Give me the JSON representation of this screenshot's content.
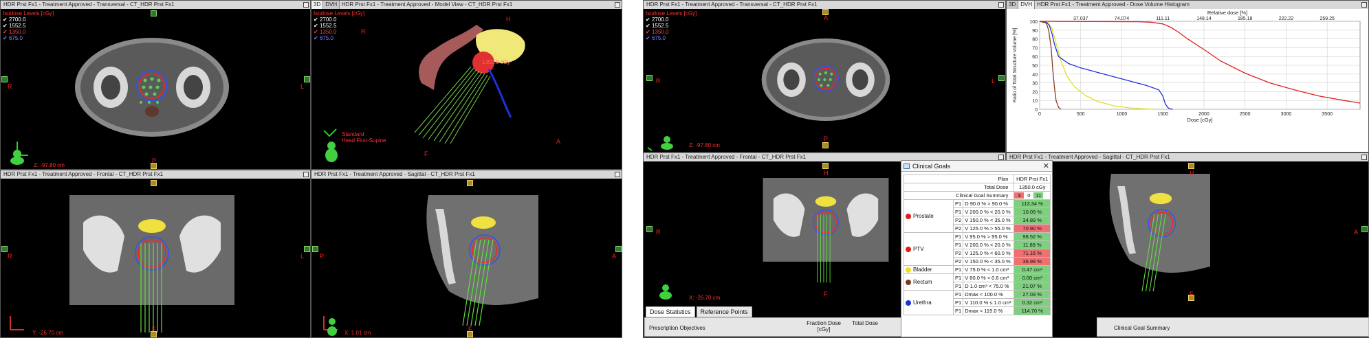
{
  "left": {
    "transversal": {
      "title": "HDR Prst Fx1 - Treatment Approved - Transversal - CT_HDR Prst Fx1",
      "legend_title": "Isodose Levels [cGy]",
      "coord": "Z: -97.80 cm",
      "labels": {
        "top": "H",
        "bottom": "P",
        "left": "R",
        "right": "L"
      }
    },
    "model_view": {
      "tab_3d": "3D",
      "tab_dvh": "DVH",
      "title": "HDR Prst Fx1 - Treatment Approved - Model View - CT_HDR Prst Fx1",
      "legend_title": "Isodose Levels [cGy]",
      "labels": {
        "top": "H",
        "right": "A",
        "left": "R",
        "bottom": "F"
      },
      "dose_label": "1350.0 cGy",
      "orientation_text": [
        "Standard",
        "Head First-Supine"
      ]
    },
    "frontal": {
      "title": "HDR Prst Fx1 - Treatment Approved - Frontal - CT_HDR Prst Fx1",
      "coord": "Y: -26.70 cm",
      "labels": {
        "top": "H",
        "bottom": "F",
        "left": "R",
        "right": "L"
      }
    },
    "sagittal": {
      "title": "HDR Prst Fx1 - Treatment Approved - Sagittal - CT_HDR Prst Fx1",
      "coord": "X: 1.01 cm",
      "labels": {
        "top": "H",
        "bottom": "F",
        "left": "P",
        "right": "A"
      }
    }
  },
  "right": {
    "transversal": {
      "title": "HDR Prst Fx1 - Treatment Approved - Transversal - CT_HDR Prst Fx1",
      "legend_title": "Isodose Levels [cGy]",
      "coord": "Z: -97.80 cm",
      "labels": {
        "top": "A",
        "bottom": "P",
        "left": "R",
        "right": "L"
      }
    },
    "dvh": {
      "tab_3d": "3D",
      "tab_dvh": "DVH",
      "title": "HDR Prst Fx1 - Treatment Approved - Dose Volume Histogram"
    },
    "frontal": {
      "title": "HDR Prst Fx1 - Treatment Approved - Frontal - CT_HDR Prst Fx1",
      "coord": "X: -26.70 cm",
      "labels": {
        "top": "H",
        "bottom": "F",
        "left": "R",
        "right": "L"
      }
    },
    "sagittal": {
      "title": "HDR Prst Fx1 - Treatment Approved - Sagittal - CT_HDR Prst Fx1",
      "labels": {
        "top": "H",
        "bottom": "F",
        "right": "A"
      }
    }
  },
  "isodose_levels": [
    "2700.0",
    "1552.5",
    "1350.0",
    "675.0"
  ],
  "isodose_colors": [
    "#ffffff",
    "#ffffff",
    "#ff3030",
    "#7070ff"
  ],
  "clinical_goals": {
    "title": "Clinical Goals",
    "plan_label": "Plan",
    "plan_name": "HDR Prst Fx1",
    "total_dose_label": "Total Dose",
    "total_dose": "1350.0 cGy",
    "summary_label": "Clinical Goal Summary",
    "summary_counts": [
      "3",
      "0",
      "11"
    ],
    "structures": [
      {
        "name": "Prostate",
        "color": "#e81818",
        "rows": [
          {
            "p": "P1",
            "goal": "D 90.0 % > 90.0 %",
            "value": "113.34 %",
            "status": "pass"
          },
          {
            "p": "P1",
            "goal": "V 200.0 % < 20.0 %",
            "value": "10.09 %",
            "status": "pass"
          },
          {
            "p": "P2",
            "goal": "V 150.0 % < 35.0 %",
            "value": "34.89 %",
            "status": "pass"
          },
          {
            "p": "P2",
            "goal": "V 125.0 % > 55.0 %",
            "value": "70.90 %",
            "status": "fail"
          }
        ]
      },
      {
        "name": "PTV",
        "color": "#e81818",
        "rows": [
          {
            "p": "P1",
            "goal": "V 95.0 % > 95.0 %",
            "value": "98.52 %",
            "status": "pass"
          },
          {
            "p": "P1",
            "goal": "V 200.0 % < 20.0 %",
            "value": "11.89 %",
            "status": "pass"
          },
          {
            "p": "P2",
            "goal": "V 125.0 % < 60.0 %",
            "value": "71.16 %",
            "status": "fail"
          },
          {
            "p": "P2",
            "goal": "V 150.0 % < 35.0 %",
            "value": "36.99 %",
            "status": "fail"
          }
        ]
      },
      {
        "name": "Bladder",
        "color": "#f0e020",
        "rows": [
          {
            "p": "P1",
            "goal": "V 75.0 % < 1.0 cm³",
            "value": "0.47 cm³",
            "status": "pass"
          }
        ]
      },
      {
        "name": "Rectum",
        "color": "#7a3a22",
        "rows": [
          {
            "p": "P1",
            "goal": "V 80.0 % < 0.6 cm³",
            "value": "0.00 cm³",
            "status": "pass"
          },
          {
            "p": "P1",
            "goal": "D 1.0 cm³ < 75.0 %",
            "value": "21.07 %",
            "status": "pass"
          }
        ]
      },
      {
        "name": "Urethra",
        "color": "#1830e0",
        "rows": [
          {
            "p": "P1",
            "goal": "Dmax < 100.0 %",
            "value": "27.03 %",
            "status": "pass"
          },
          {
            "p": "P1",
            "goal": "V 110.0 % ≤ 1.0 cm³",
            "value": "0.32 cm³",
            "status": "pass"
          },
          {
            "p": "P1",
            "goal": "Dmax < 115.0 %",
            "value": "114.70 %",
            "status": "pass"
          }
        ]
      }
    ]
  },
  "bottom": {
    "tab_dose_statistics": "Dose Statistics",
    "tab_reference_points": "Reference Points",
    "prescription_objectives": "Prescription Objectives",
    "fraction_dose": "Fraction Dose [cGy]",
    "total_dose": "Total Dose",
    "clinical_goal_summary": "Clinical Goal Summary"
  },
  "chart_data": {
    "type": "line",
    "title": "",
    "xlabel": "Dose [cGy]",
    "ylabel": "Ratio of Total Structure Volume [%]",
    "x2label": "Relative dose [%]",
    "xlim": [
      0,
      3900
    ],
    "ylim": [
      0,
      100
    ],
    "xticks": [
      0,
      500,
      1000,
      1500,
      2000,
      2500,
      3000,
      3500
    ],
    "yticks": [
      0,
      10,
      20,
      30,
      40,
      50,
      60,
      70,
      80,
      90,
      100
    ],
    "x2ticks": [
      "37.037",
      "74.074",
      "111.11",
      "148.14",
      "185.18",
      "222.22",
      "259.25"
    ],
    "x2tick_dose": [
      500,
      1000,
      1500,
      2000,
      2500,
      3000,
      3500
    ],
    "grid": true,
    "series": [
      {
        "color": "#e02020",
        "x": [
          0,
          1200,
          1350,
          1500,
          1600,
          1700,
          1800,
          2000,
          2200,
          2500,
          2800,
          3100,
          3400,
          3700,
          3900
        ],
        "y": [
          100,
          99.5,
          99,
          97,
          93,
          87,
          80,
          68,
          55,
          41,
          30,
          22,
          15,
          10,
          7
        ]
      },
      {
        "color": "#e0e020",
        "x": [
          0,
          100,
          150,
          200,
          260,
          330,
          420,
          550,
          700,
          900,
          1100,
          1300,
          1400
        ],
        "y": [
          100,
          99,
          92,
          75,
          55,
          38,
          26,
          16,
          9,
          4,
          1.5,
          0.3,
          0
        ]
      },
      {
        "color": "#2030e0",
        "x": [
          0,
          80,
          120,
          150,
          180,
          230,
          350,
          500,
          700,
          900,
          1100,
          1300,
          1450,
          1500,
          1530,
          1560,
          1580,
          1620
        ],
        "y": [
          100,
          99,
          95,
          86,
          74,
          60,
          52,
          47,
          42,
          37,
          32,
          27,
          22,
          15,
          6,
          2,
          0.5,
          0
        ]
      },
      {
        "color": "#8a3a22",
        "x": [
          0,
          80,
          110,
          140,
          160,
          180,
          200,
          230,
          260
        ],
        "y": [
          100,
          98,
          90,
          70,
          45,
          25,
          10,
          2,
          0
        ]
      }
    ]
  }
}
